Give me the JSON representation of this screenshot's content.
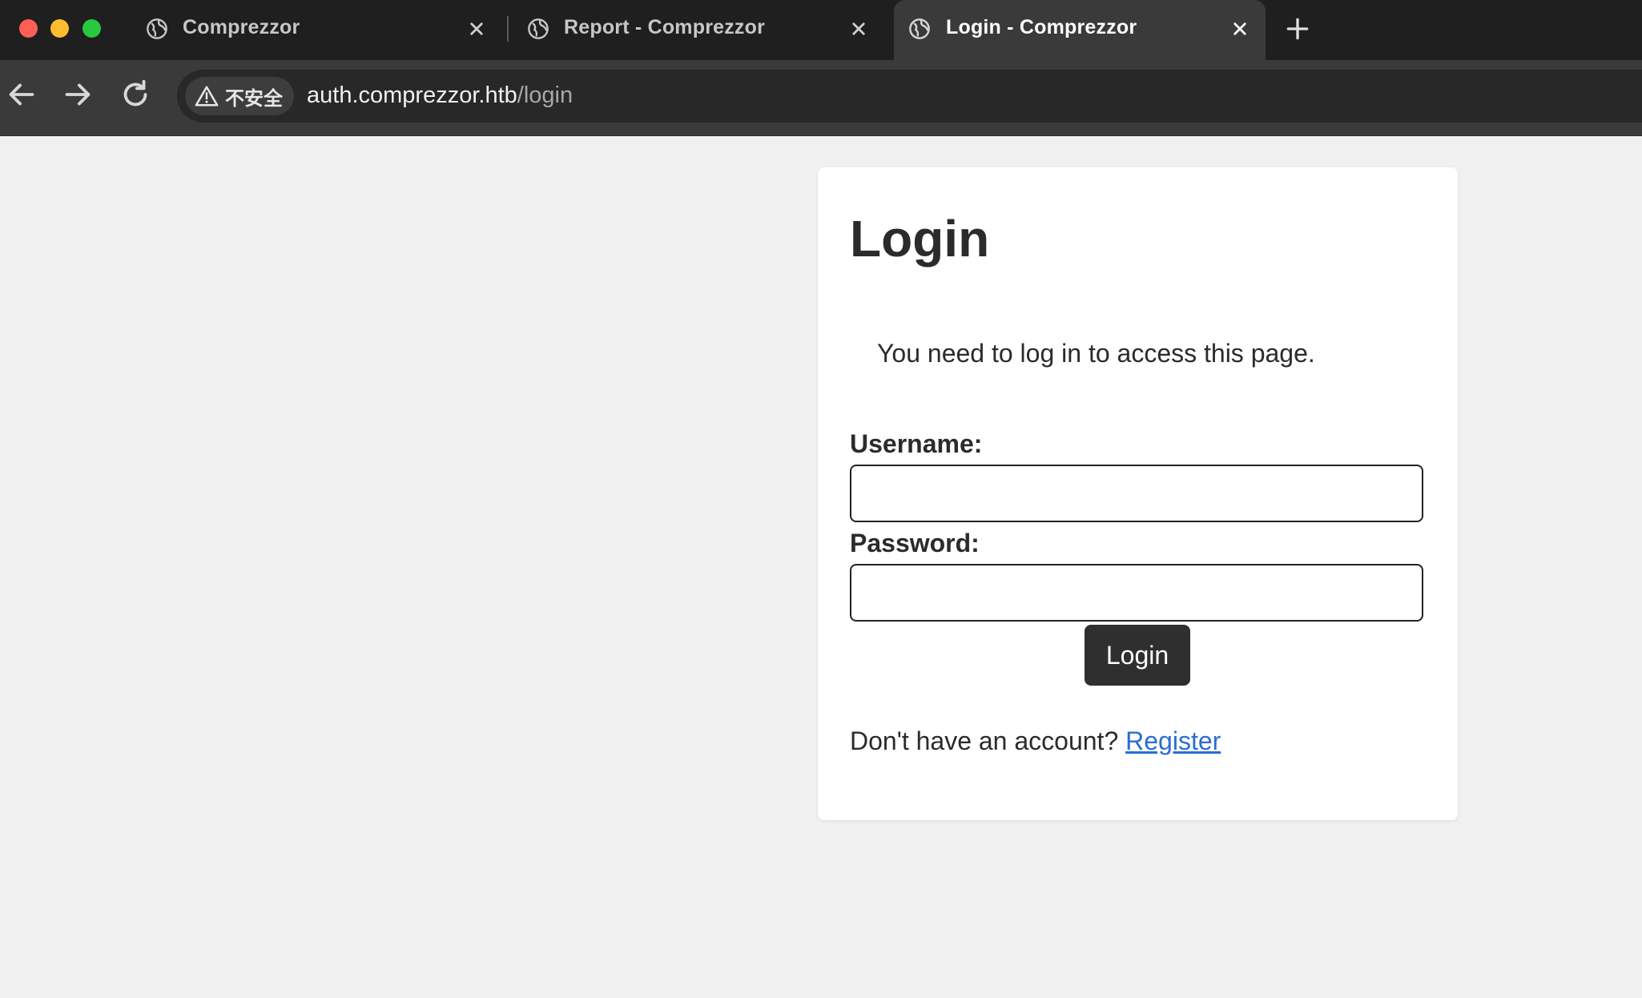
{
  "browser": {
    "tabs": [
      {
        "title": "Comprezzor",
        "active": false
      },
      {
        "title": "Report - Comprezzor",
        "active": false
      },
      {
        "title": "Login - Comprezzor",
        "active": true
      }
    ],
    "security_label": "不安全",
    "url_host": "auth.comprezzor.htb",
    "url_path": "/login"
  },
  "page": {
    "heading": "Login",
    "flash_message": "You need to log in to access this page.",
    "username_label": "Username:",
    "username_value": "",
    "password_label": "Password:",
    "password_value": "",
    "submit_label": "Login",
    "register_prompt": "Don't have an account?",
    "register_link": "Register"
  },
  "colors": {
    "page_background": "#f0f0f0",
    "button_background": "#2f2f2f",
    "link": "#2a6dd4"
  }
}
